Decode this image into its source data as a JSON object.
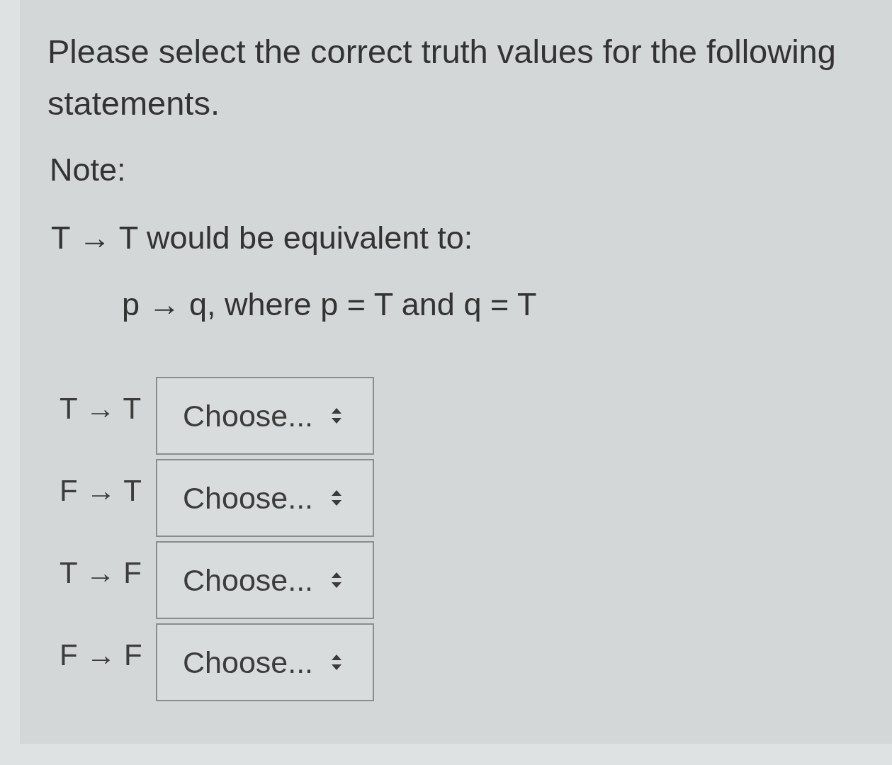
{
  "instructions": {
    "text": "Please select the correct truth values for the following statements."
  },
  "note": {
    "label": "Note:",
    "example": "T → T would be equivalent to:",
    "explanation": "p → q, where p = T and q = T"
  },
  "statements": [
    {
      "label": "T → T",
      "select": {
        "value": "Choose..."
      }
    },
    {
      "label": "F → T",
      "select": {
        "value": "Choose..."
      }
    },
    {
      "label": "T → F",
      "select": {
        "value": "Choose..."
      }
    },
    {
      "label": "F → F",
      "select": {
        "value": "Choose..."
      }
    }
  ]
}
